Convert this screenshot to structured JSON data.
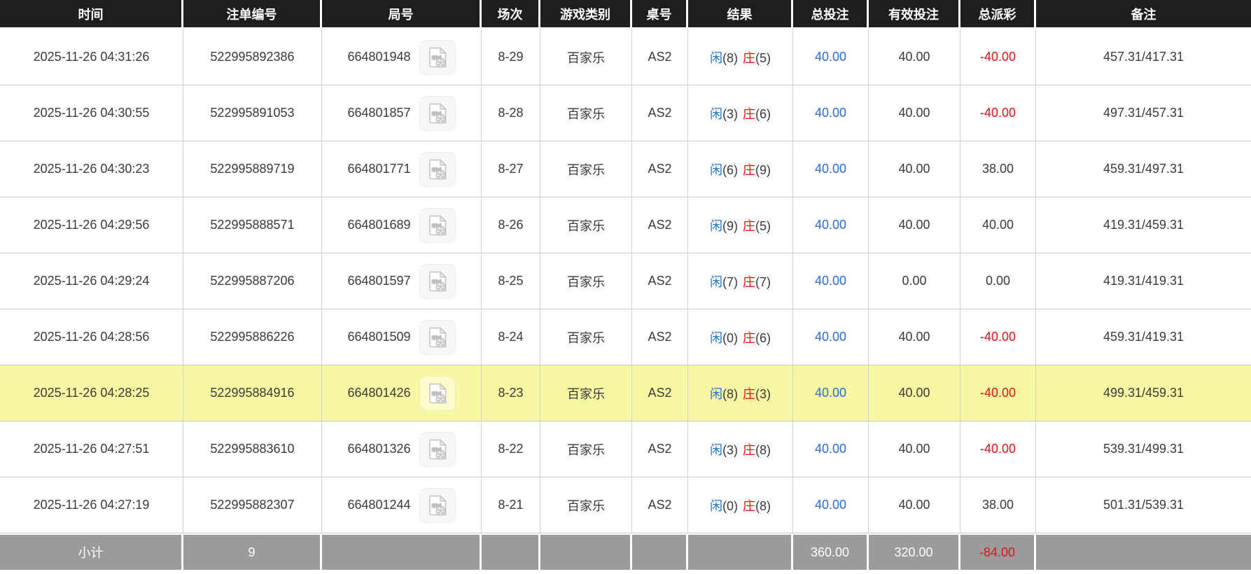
{
  "table": {
    "columns": [
      "时间",
      "注单编号",
      "局号",
      "场次",
      "游戏类别",
      "桌号",
      "结果",
      "总投注",
      "有效投注",
      "总派彩",
      "备注"
    ],
    "rows": [
      {
        "time": "2025-11-26 04:31:26",
        "bet_id": "522995892386",
        "round_id": "664801948",
        "session": "8-29",
        "game_type": "百家乐",
        "table_no": "AS2",
        "result": {
          "player_label": "闲",
          "player_points": "(8)",
          "banker_label": "庄",
          "banker_points": "(5)"
        },
        "total_bet": "40.00",
        "valid_bet": "40.00",
        "total_payout": "-40.00",
        "remark": "457.31/417.31",
        "highlighted": false
      },
      {
        "time": "2025-11-26 04:30:55",
        "bet_id": "522995891053",
        "round_id": "664801857",
        "session": "8-28",
        "game_type": "百家乐",
        "table_no": "AS2",
        "result": {
          "player_label": "闲",
          "player_points": "(3)",
          "banker_label": "庄",
          "banker_points": "(6)"
        },
        "total_bet": "40.00",
        "valid_bet": "40.00",
        "total_payout": "-40.00",
        "remark": "497.31/457.31",
        "highlighted": false
      },
      {
        "time": "2025-11-26 04:30:23",
        "bet_id": "522995889719",
        "round_id": "664801771",
        "session": "8-27",
        "game_type": "百家乐",
        "table_no": "AS2",
        "result": {
          "player_label": "闲",
          "player_points": "(6)",
          "banker_label": "庄",
          "banker_points": "(9)"
        },
        "total_bet": "40.00",
        "valid_bet": "40.00",
        "total_payout": "38.00",
        "remark": "459.31/497.31",
        "highlighted": false
      },
      {
        "time": "2025-11-26 04:29:56",
        "bet_id": "522995888571",
        "round_id": "664801689",
        "session": "8-26",
        "game_type": "百家乐",
        "table_no": "AS2",
        "result": {
          "player_label": "闲",
          "player_points": "(9)",
          "banker_label": "庄",
          "banker_points": "(5)"
        },
        "total_bet": "40.00",
        "valid_bet": "40.00",
        "total_payout": "40.00",
        "remark": "419.31/459.31",
        "highlighted": false
      },
      {
        "time": "2025-11-26 04:29:24",
        "bet_id": "522995887206",
        "round_id": "664801597",
        "session": "8-25",
        "game_type": "百家乐",
        "table_no": "AS2",
        "result": {
          "player_label": "闲",
          "player_points": "(7)",
          "banker_label": "庄",
          "banker_points": "(7)"
        },
        "total_bet": "40.00",
        "valid_bet": "0.00",
        "total_payout": "0.00",
        "remark": "419.31/419.31",
        "highlighted": false
      },
      {
        "time": "2025-11-26 04:28:56",
        "bet_id": "522995886226",
        "round_id": "664801509",
        "session": "8-24",
        "game_type": "百家乐",
        "table_no": "AS2",
        "result": {
          "player_label": "闲",
          "player_points": "(0)",
          "banker_label": "庄",
          "banker_points": "(6)"
        },
        "total_bet": "40.00",
        "valid_bet": "40.00",
        "total_payout": "-40.00",
        "remark": "459.31/419.31",
        "highlighted": false
      },
      {
        "time": "2025-11-26 04:28:25",
        "bet_id": "522995884916",
        "round_id": "664801426",
        "session": "8-23",
        "game_type": "百家乐",
        "table_no": "AS2",
        "result": {
          "player_label": "闲",
          "player_points": "(8)",
          "banker_label": "庄",
          "banker_points": "(3)"
        },
        "total_bet": "40.00",
        "valid_bet": "40.00",
        "total_payout": "-40.00",
        "remark": "499.31/459.31",
        "highlighted": true
      },
      {
        "time": "2025-11-26 04:27:51",
        "bet_id": "522995883610",
        "round_id": "664801326",
        "session": "8-22",
        "game_type": "百家乐",
        "table_no": "AS2",
        "result": {
          "player_label": "闲",
          "player_points": "(3)",
          "banker_label": "庄",
          "banker_points": "(8)"
        },
        "total_bet": "40.00",
        "valid_bet": "40.00",
        "total_payout": "-40.00",
        "remark": "539.31/499.31",
        "highlighted": false
      },
      {
        "time": "2025-11-26 04:27:19",
        "bet_id": "522995882307",
        "round_id": "664801244",
        "session": "8-21",
        "game_type": "百家乐",
        "table_no": "AS2",
        "result": {
          "player_label": "闲",
          "player_points": "(0)",
          "banker_label": "庄",
          "banker_points": "(8)"
        },
        "total_bet": "40.00",
        "valid_bet": "40.00",
        "total_payout": "38.00",
        "remark": "501.31/539.31",
        "highlighted": false
      }
    ],
    "subtotal": {
      "label": "小计",
      "count": "9",
      "total_bet": "360.00",
      "valid_bet": "320.00",
      "total_payout": "-84.00",
      "remark": ""
    }
  },
  "icons": {
    "video_button": "video-file-icon"
  },
  "colors": {
    "header_bg": "#1e1e1e",
    "accent_blue": "#2a6ce0",
    "accent_red": "#e01515",
    "row_highlight": "#f8f8a2",
    "subtotal_bg": "#9b9b9b"
  }
}
